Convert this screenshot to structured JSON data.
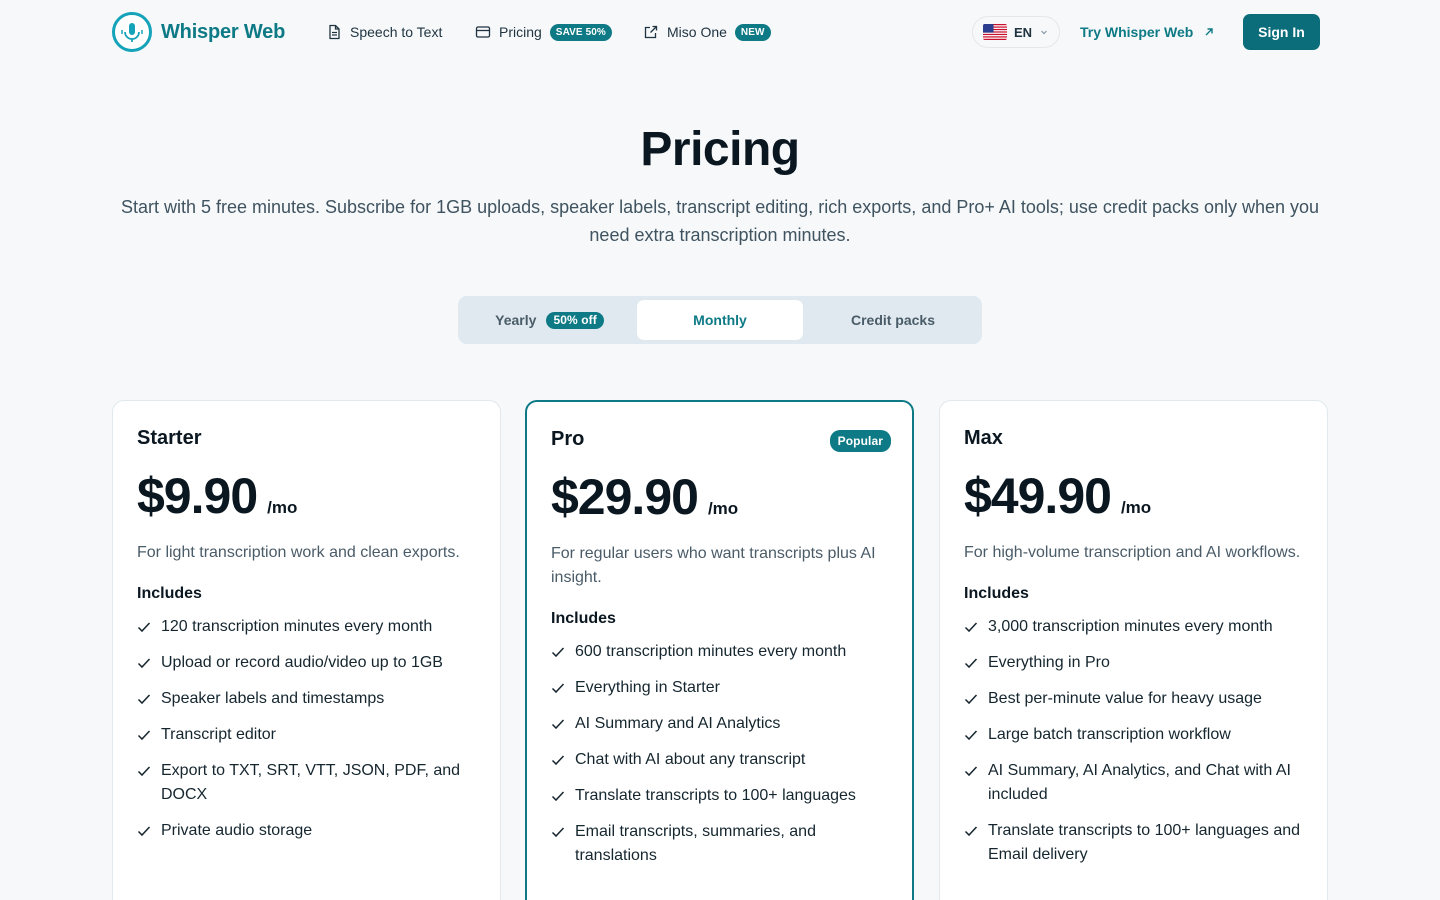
{
  "brand": {
    "name": "Whisper Web",
    "accent": "#0e7a86"
  },
  "nav": {
    "links": [
      {
        "label": "Speech to Text",
        "icon": "document-icon"
      },
      {
        "label": "Pricing",
        "icon": "card-icon",
        "badge": "SAVE 50%"
      },
      {
        "label": "Miso One",
        "icon": "external-link-icon",
        "badge": "NEW"
      }
    ],
    "language": "EN",
    "try_label": "Try Whisper Web",
    "signin_label": "Sign In"
  },
  "hero": {
    "title": "Pricing",
    "subtitle": "Start with 5 free minutes. Subscribe for 1GB uploads, speaker labels, transcript editing, rich exports, and Pro+ AI tools; use credit packs only when you need extra transcription minutes."
  },
  "billing_toggle": {
    "options": [
      {
        "label": "Yearly",
        "badge": "50% off"
      },
      {
        "label": "Monthly"
      },
      {
        "label": "Credit packs"
      }
    ],
    "selected": "Monthly"
  },
  "plans": [
    {
      "name": "Starter",
      "price": "$9.90",
      "period": "/mo",
      "description": "For light transcription work and clean exports.",
      "includes_label": "Includes",
      "features": [
        "120 transcription minutes every month",
        "Upload or record audio/video up to 1GB",
        "Speaker labels and timestamps",
        "Transcript editor",
        "Export to TXT, SRT, VTT, JSON, PDF, and DOCX",
        "Private audio storage"
      ]
    },
    {
      "name": "Pro",
      "badge": "Popular",
      "price": "$29.90",
      "period": "/mo",
      "description": "For regular users who want transcripts plus AI insight.",
      "includes_label": "Includes",
      "features": [
        "600 transcription minutes every month",
        "Everything in Starter",
        "AI Summary and AI Analytics",
        "Chat with AI about any transcript",
        "Translate transcripts to 100+ languages",
        "Email transcripts, summaries, and translations"
      ]
    },
    {
      "name": "Max",
      "price": "$49.90",
      "period": "/mo",
      "description": "For high-volume transcription and AI workflows.",
      "includes_label": "Includes",
      "features": [
        "3,000 transcription minutes every month",
        "Everything in Pro",
        "Best per-minute value for heavy usage",
        "Large batch transcription workflow",
        "AI Summary, AI Analytics, and Chat with AI included",
        "Translate transcripts to 100+ languages and Email delivery"
      ]
    }
  ]
}
